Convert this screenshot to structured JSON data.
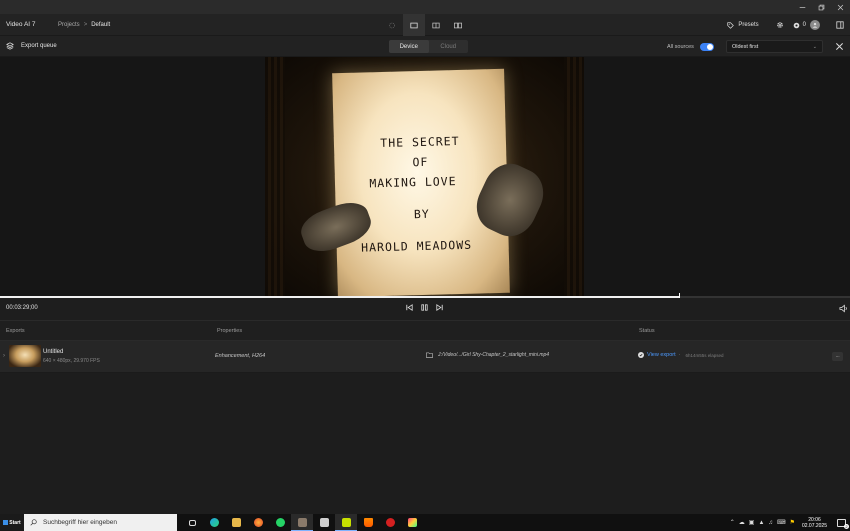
{
  "app": {
    "name": "Video AI 7"
  },
  "breadcrumb": {
    "root": "Projects",
    "current": "Default"
  },
  "header": {
    "presets_label": "Presets",
    "credits": "0"
  },
  "queue": {
    "title": "Export queue",
    "tabs": [
      {
        "label": "Device",
        "active": true
      },
      {
        "label": "Cloud",
        "active": false
      }
    ],
    "all_sources_label": "All sources",
    "all_sources_on": true,
    "sort_value": "Oldest first"
  },
  "preview": {
    "paper_lines": [
      "THE SECRET",
      "OF",
      "MAKING LOVE",
      "BY",
      "HAROLD MEADOWS"
    ]
  },
  "transport": {
    "timecode": "00:03:29;00",
    "progress": 0.8
  },
  "table": {
    "headers": {
      "exports": "Exports",
      "properties": "Properties",
      "status": "Status"
    },
    "rows": [
      {
        "name": "Untitled",
        "meta": "640 × 480px, 29.970 FPS",
        "properties": "Enhancement, H264",
        "path": "J:/Video/.../Girl Shy-Chapter_2_starlight_mini.mp4",
        "status_link": "View export",
        "status_sep": "·",
        "elapsed": "6h14m55s elapsed",
        "more": "···"
      }
    ]
  },
  "taskbar": {
    "start_label": "Start",
    "search_placeholder": "Suchbegriff hier eingeben",
    "time": "20:06",
    "date": "02.07.2025"
  },
  "colors": {
    "accent": "#3b82f6",
    "link": "#4c9aff"
  }
}
